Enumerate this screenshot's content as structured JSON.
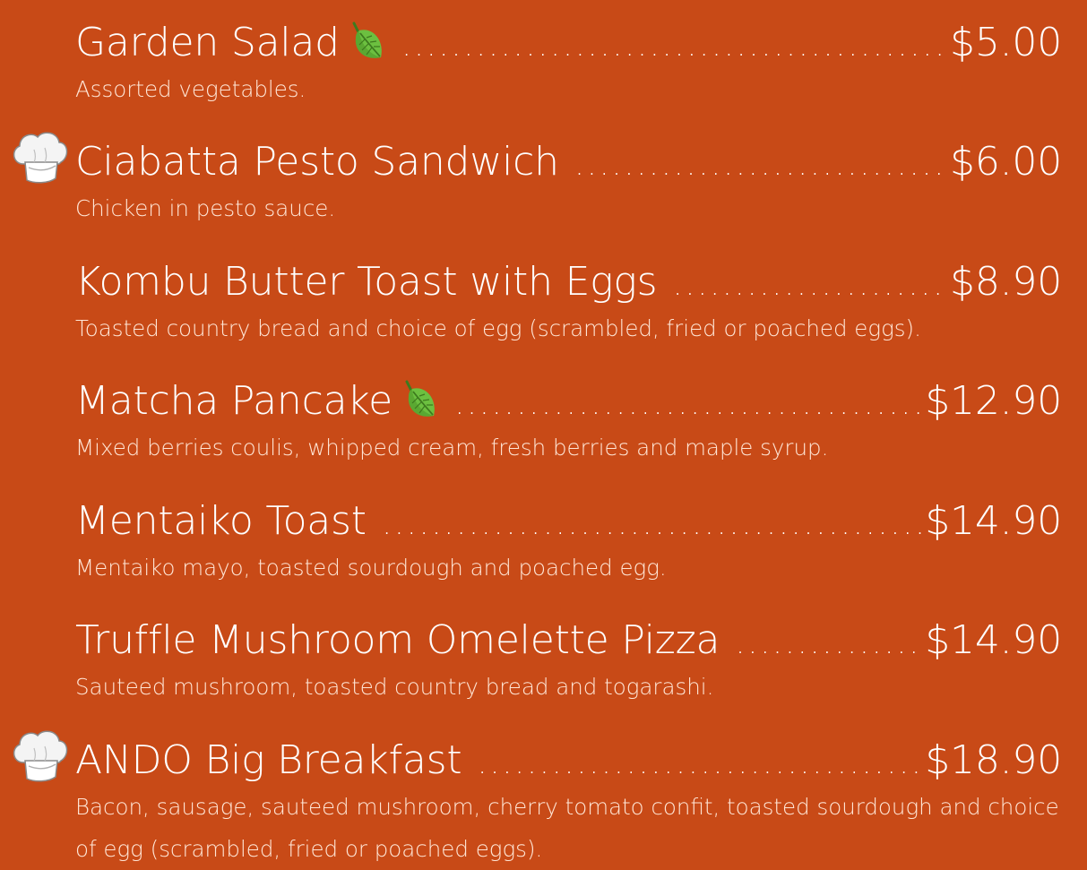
{
  "menu": {
    "items": [
      {
        "name": "Garden Salad",
        "price": "$5.00",
        "description": "Assorted vegetables.",
        "vegetarian": true,
        "chef_recommended": false
      },
      {
        "name": "Ciabatta Pesto Sandwich",
        "price": "$6.00",
        "description": "Chicken in pesto sauce.",
        "vegetarian": false,
        "chef_recommended": true
      },
      {
        "name": "Kombu Butter Toast with Eggs",
        "price": "$8.90",
        "description": "Toasted country bread and choice of egg (scrambled, fried or poached eggs).",
        "vegetarian": false,
        "chef_recommended": false
      },
      {
        "name": "Matcha Pancake",
        "price": "$12.90",
        "description": "Mixed berries coulis, whipped cream, fresh berries and maple syrup.",
        "vegetarian": true,
        "chef_recommended": false
      },
      {
        "name": "Mentaiko Toast",
        "price": "$14.90",
        "description": "Mentaiko mayo, toasted sourdough and poached egg.",
        "vegetarian": false,
        "chef_recommended": false
      },
      {
        "name": "Truffle Mushroom Omelette Pizza",
        "price": "$14.90",
        "description": "Sauteed mushroom, toasted country bread and togarashi.",
        "vegetarian": false,
        "chef_recommended": false
      },
      {
        "name": "ANDO Big Breakfast",
        "price": "$18.90",
        "description": "Bacon, sausage, sauteed mushroom, cherry tomato confit, toasted sourdough and choice of egg (scrambled, fried or poached eggs).",
        "vegetarian": false,
        "chef_recommended": true
      }
    ]
  },
  "colors": {
    "background": "#c84a17",
    "text": "#ffffff",
    "description_text": "#ffe6d6",
    "leaf_green": "#5aa832"
  },
  "icons": {
    "vegetarian": "leaf-icon",
    "chef_recommended": "chef-hat-icon"
  }
}
